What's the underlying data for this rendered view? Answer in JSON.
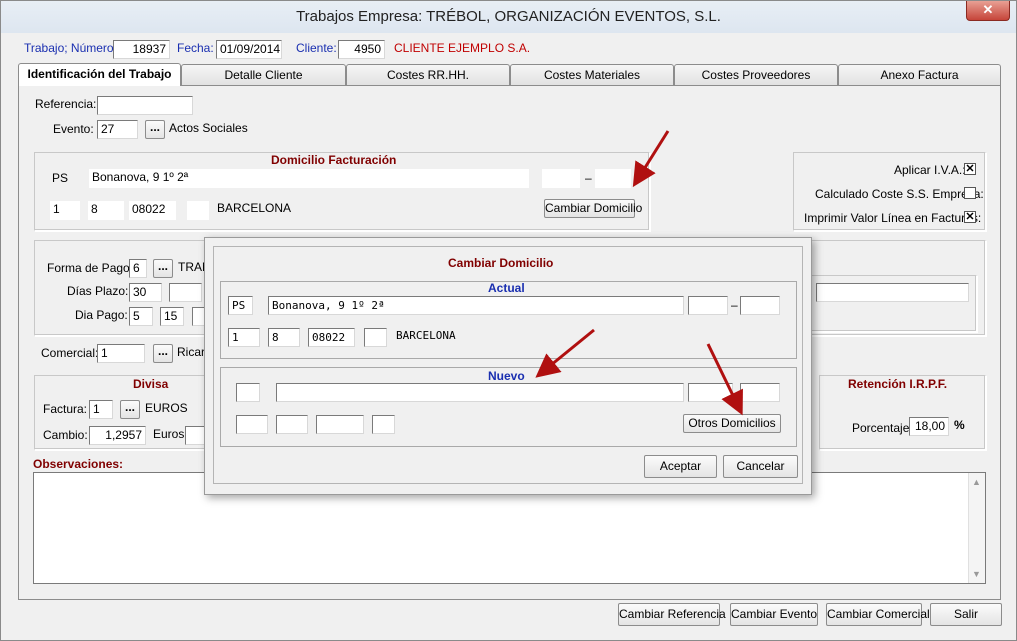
{
  "window": {
    "title": "Trabajos Empresa: TRÉBOL, ORGANIZACIÓN EVENTOS, S.L.",
    "close": "✕"
  },
  "header": {
    "trabajo_label": "Trabajo; Número:",
    "trabajo_value": "18937",
    "fecha_label": "Fecha:",
    "fecha_value": "01/09/2014",
    "cliente_label": "Cliente:",
    "cliente_value": "4950",
    "cliente_name": "CLIENTE EJEMPLO S.A."
  },
  "tabs": [
    "Identificación del Trabajo",
    "Detalle Cliente",
    "Costes RR.HH.",
    "Costes Materiales",
    "Costes Proveedores",
    "Anexo Factura"
  ],
  "ident": {
    "referencia_label": "Referencia:",
    "referencia_value": "",
    "evento_label": "Evento:",
    "evento_value": "27",
    "evento_name": "Actos Sociales",
    "ellipsis": "..."
  },
  "domicilio": {
    "title": "Domicilio Facturación",
    "via": "PS",
    "calle": "Bonanova, 9 1º 2ª",
    "dash": "–",
    "f1": "1",
    "f2": "8",
    "cp": "08022",
    "ciudad": "BARCELONA",
    "cambiar_btn": "Cambiar Domicilio"
  },
  "options": {
    "iva_label": "Aplicar I.V.A.:",
    "iva_checked": "✕",
    "ss_label": "Calculado Coste S.S. Empresa:",
    "ss_checked": "",
    "linea_label": "Imprimir Valor Línea en Facturas:",
    "linea_checked": "✕"
  },
  "pago": {
    "forma_label": "Forma de Pago:",
    "forma_value": "6",
    "forma_text": "TRAN",
    "plazo_label": "Días Plazo:",
    "plazo_value": "30",
    "dia_label": "Dia Pago:",
    "dia1": "5",
    "dia2": "15",
    "comercial_label": "Comercial:",
    "comercial_value": "1",
    "comercial_text": "Ricar"
  },
  "divisa": {
    "title": "Divisa",
    "factura_label": "Factura:",
    "factura_value": "1",
    "factura_text": "EUROS",
    "cambio_label": "Cambio:",
    "cambio_value": "1,2957",
    "cambio_text": "Euros"
  },
  "irpf": {
    "title": "Retención I.R.P.F.",
    "porcentaje_label": "Porcentaje:",
    "porcentaje_value": "18,00",
    "pct": "%"
  },
  "observaciones": {
    "label": "Observaciones:"
  },
  "dialog": {
    "title": "Cambiar Domicilio",
    "actual_title": "Actual",
    "actual": {
      "via": "PS",
      "calle": "Bonanova, 9 1º 2ª",
      "dash": "–",
      "f1": "1",
      "f2": "8",
      "cp": "08022",
      "ciudad": "BARCELONA"
    },
    "nuevo_title": "Nuevo",
    "otros_btn": "Otros Domicilios",
    "aceptar_btn": "Aceptar",
    "cancelar_btn": "Cancelar"
  },
  "footer": {
    "cambiar_referencia": "Cambiar Referencia",
    "cambiar_evento": "Cambiar Evento",
    "cambiar_comercial": "Cambiar Comercial",
    "salir": "Salir"
  },
  "colors": {
    "accent_red": "#c00000",
    "maroon": "#800000",
    "blue": "#1a2fb0",
    "arrow": "#b01010"
  }
}
